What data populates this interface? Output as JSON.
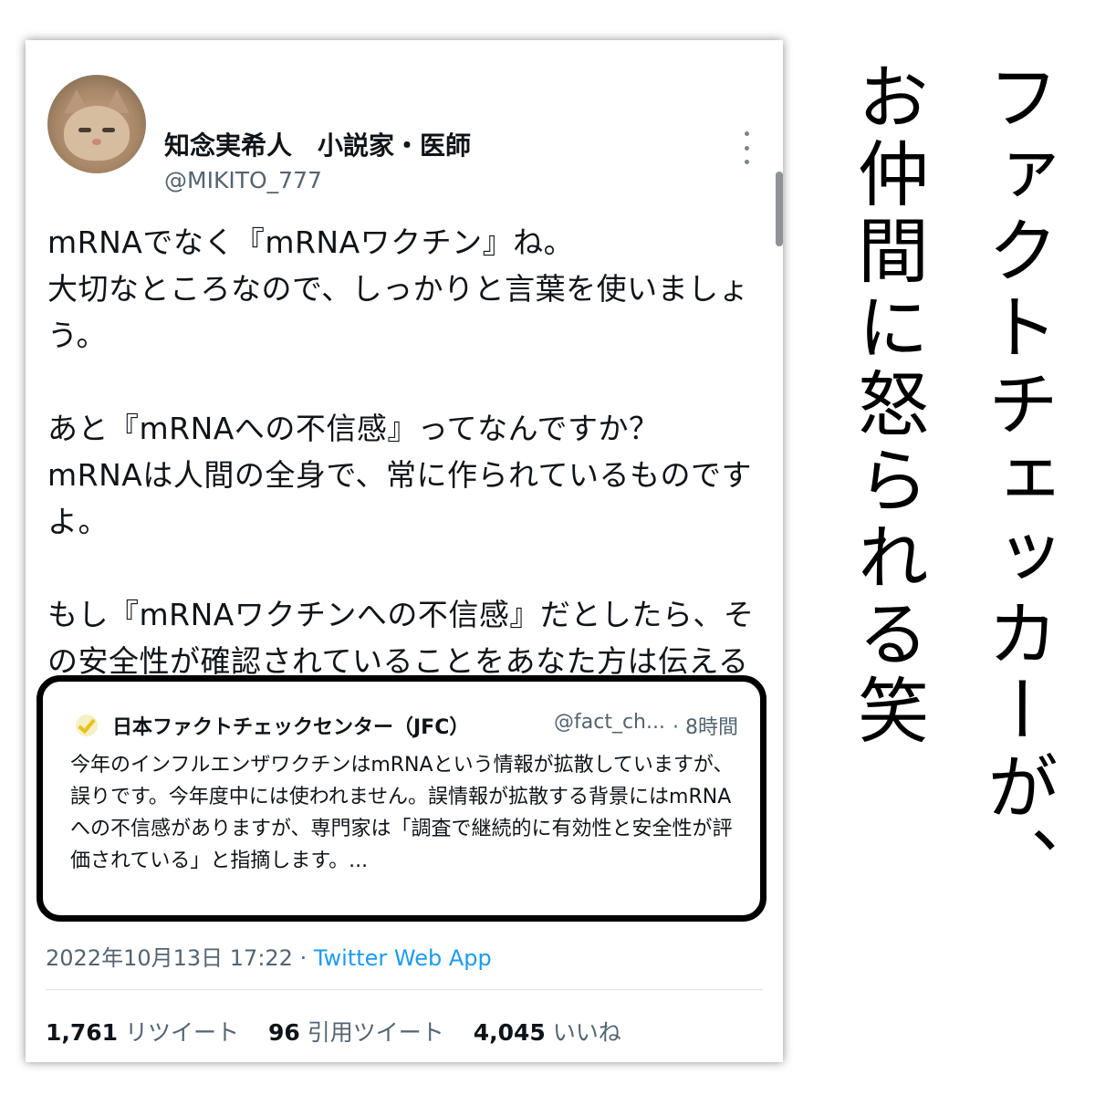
{
  "tweet": {
    "author": {
      "display_name": "知念実希人　小説家・医師",
      "handle": "@MIKITO_777"
    },
    "text": "mRNAでなく『mRNAワクチン』ね。\n大切なところなので、しっかりと言葉を使いましょう。\n\nあと『mRNAへの不信感』ってなんですか？\nmRNAは人間の全身で、常に作られているものですよ。\n\nもし『mRNAワクチンへの不信感』だとしたら、その安全性が確認されていることをあなた方は伝えるべきでしょ。",
    "quoted": {
      "name": "日本ファクトチェックセンター（JFC）",
      "handle": "@fact_ch...",
      "time": "· 8時間",
      "text": "今年のインフルエンザワクチンはmRNAという情報が拡散していますが、誤りです。今年度中には使われません。誤情報が拡散する背景にはmRNAへの不信感がありますが、専門家は「調査で継続的に有効性と安全性が評価されている」と指摘します。..."
    },
    "timestamp": "2022年10月13日 17:22 · ",
    "source": "Twitter Web App",
    "stats": {
      "retweets_count": "1,761",
      "retweets_label": "リツイート",
      "quotes_count": "96",
      "quotes_label": "引用ツイート",
      "likes_count": "4,045",
      "likes_label": "いいね"
    }
  },
  "caption": {
    "column_1": "ファクトチェッカーが、",
    "column_2": "お仲間に怒られる笑"
  },
  "colors": {
    "text": "#0f1419",
    "secondary": "#536471",
    "link": "#1d9bf0",
    "quote_border": "#000000"
  }
}
